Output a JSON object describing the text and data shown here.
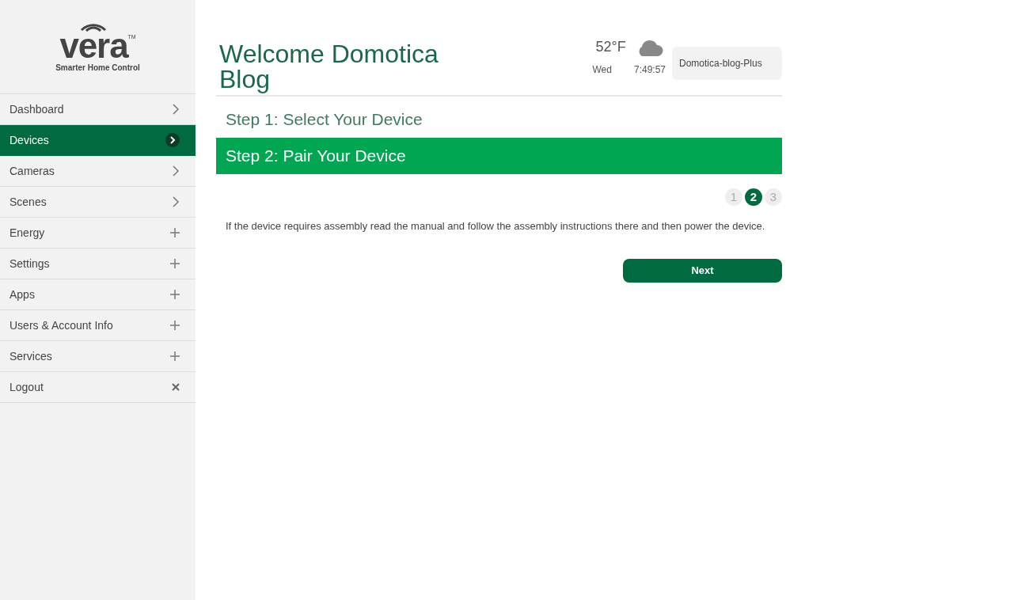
{
  "logo": {
    "wordmark": "vera",
    "trademark": "TM",
    "tagline": "Smarter Home Control"
  },
  "sidebar": {
    "items": [
      {
        "label": "Dashboard",
        "kind": "chevron",
        "selected": false
      },
      {
        "label": "Devices",
        "kind": "chevron",
        "selected": true
      },
      {
        "label": "Cameras",
        "kind": "chevron",
        "selected": false
      },
      {
        "label": "Scenes",
        "kind": "chevron",
        "selected": false
      },
      {
        "label": "Energy",
        "kind": "plus",
        "selected": false
      },
      {
        "label": "Settings",
        "kind": "plus",
        "selected": false
      },
      {
        "label": "Apps",
        "kind": "plus",
        "selected": false
      },
      {
        "label": "Users & Account Info",
        "kind": "plus",
        "selected": false
      },
      {
        "label": "Services",
        "kind": "plus",
        "selected": false
      },
      {
        "label": "Logout",
        "kind": "close",
        "selected": false
      }
    ]
  },
  "header": {
    "title": "Welcome Domotica Blog",
    "temperature": "52°F",
    "day": "Wed",
    "time": "7:49:57",
    "controller": "Domotica-blog-Plus"
  },
  "steps": [
    {
      "label": "Step 1: Select Your Device",
      "selected": false
    },
    {
      "label": "Step 2: Pair Your Device",
      "selected": true
    }
  ],
  "pager": [
    {
      "label": "1",
      "selected": false
    },
    {
      "label": "2",
      "selected": true
    },
    {
      "label": "3",
      "selected": false
    }
  ],
  "instruction": "If the device requires assembly read the manual and follow the assembly instructions there and then power the device.",
  "next_button": "Next"
}
